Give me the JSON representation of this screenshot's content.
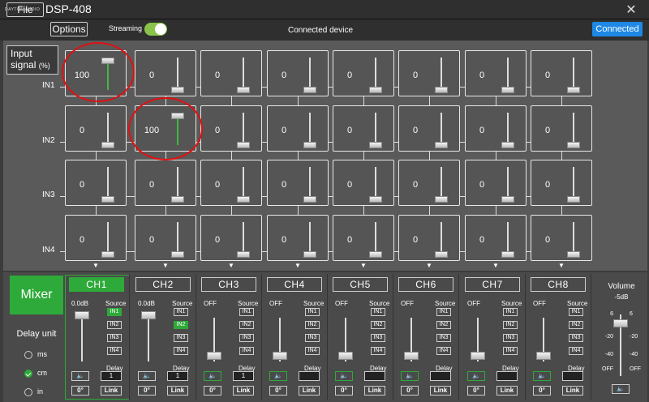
{
  "app": {
    "logo_text": "DAYTON AUDIO",
    "title": "DSP-408",
    "close": "✕"
  },
  "menu": {
    "file": "File",
    "options": "Options",
    "streaming_label": "Streaming",
    "streaming_on": true,
    "connection_status": "Connected device",
    "connected_button": "Connected"
  },
  "grid": {
    "input_label_line1": "Input",
    "input_label_line2": "signal",
    "input_label_unit": "(%)",
    "rows": [
      {
        "label": "IN1",
        "values": [
          "100",
          "0",
          "0",
          "0",
          "0",
          "0",
          "0",
          "0"
        ]
      },
      {
        "label": "IN2",
        "values": [
          "0",
          "100",
          "0",
          "0",
          "0",
          "0",
          "0",
          "0"
        ]
      },
      {
        "label": "IN3",
        "values": [
          "0",
          "0",
          "0",
          "0",
          "0",
          "0",
          "0",
          "0"
        ]
      },
      {
        "label": "IN4",
        "values": [
          "0",
          "0",
          "0",
          "0",
          "0",
          "0",
          "0",
          "0"
        ]
      }
    ]
  },
  "mixer": {
    "button": "Mixer",
    "delay_unit_label": "Delay unit",
    "units": [
      "ms",
      "cm",
      "in"
    ],
    "selected_unit": "cm"
  },
  "channels": [
    {
      "name": "CH1",
      "gain": "0.0dB",
      "source_label": "Source",
      "sources": [
        "IN1",
        "IN2",
        "IN3",
        "IN4"
      ],
      "selected_source": "IN1",
      "delay_label": "Delay",
      "delay": "1",
      "phase": "0°",
      "link": "Link",
      "active": true,
      "muted": false
    },
    {
      "name": "CH2",
      "gain": "0.0dB",
      "source_label": "Source",
      "sources": [
        "IN1",
        "IN2",
        "IN3",
        "IN4"
      ],
      "selected_source": "IN2",
      "delay_label": "Delay",
      "delay": "1",
      "phase": "0°",
      "link": "Link",
      "active": false,
      "muted": false
    },
    {
      "name": "CH3",
      "gain": "OFF",
      "source_label": "Source",
      "sources": [
        "IN1",
        "IN2",
        "IN3",
        "IN4"
      ],
      "selected_source": "",
      "delay_label": "Delay",
      "delay": "1",
      "phase": "0°",
      "link": "Link",
      "active": false,
      "muted": true
    },
    {
      "name": "CH4",
      "gain": "OFF",
      "source_label": "Source",
      "sources": [
        "IN1",
        "IN2",
        "IN3",
        "IN4"
      ],
      "selected_source": "",
      "delay_label": "Delay",
      "delay": "",
      "phase": "0°",
      "link": "Link",
      "active": false,
      "muted": true
    },
    {
      "name": "CH5",
      "gain": "OFF",
      "source_label": "Source",
      "sources": [
        "IN1",
        "IN2",
        "IN3",
        "IN4"
      ],
      "selected_source": "",
      "delay_label": "Delay",
      "delay": "",
      "phase": "0°",
      "link": "Link",
      "active": false,
      "muted": true
    },
    {
      "name": "CH6",
      "gain": "OFF",
      "source_label": "Source",
      "sources": [
        "IN1",
        "IN2",
        "IN3",
        "IN4"
      ],
      "selected_source": "",
      "delay_label": "Delay",
      "delay": "",
      "phase": "0°",
      "link": "Link",
      "active": false,
      "muted": true
    },
    {
      "name": "CH7",
      "gain": "OFF",
      "source_label": "Source",
      "sources": [
        "IN1",
        "IN2",
        "IN3",
        "IN4"
      ],
      "selected_source": "",
      "delay_label": "Delay",
      "delay": "",
      "phase": "0°",
      "link": "Link",
      "active": false,
      "muted": true
    },
    {
      "name": "CH8",
      "gain": "OFF",
      "source_label": "Source",
      "sources": [
        "IN1",
        "IN2",
        "IN3",
        "IN4"
      ],
      "selected_source": "",
      "delay_label": "Delay",
      "delay": "",
      "phase": "0°",
      "link": "Link",
      "active": false,
      "muted": true
    }
  ],
  "volume": {
    "label": "Volume",
    "value": "-5dB",
    "scale_left": [
      "6",
      "-20",
      "-40",
      "OFF"
    ],
    "scale_right": [
      "6",
      "-20",
      "-40",
      "OFF"
    ],
    "level_db": -5
  },
  "colors": {
    "accent_green": "#2eaa3a",
    "connected_blue": "#1e88e5",
    "highlight_red": "#e01010"
  }
}
